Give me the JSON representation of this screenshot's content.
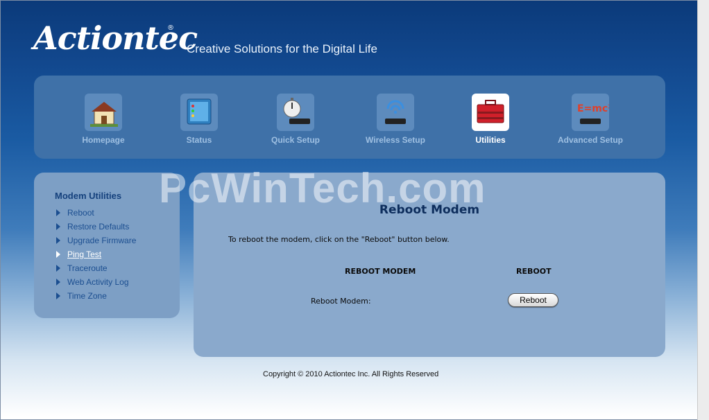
{
  "brand": {
    "logo_text": "Actiontec",
    "registered_mark": "®",
    "tagline": "Creative Solutions for the Digital Life"
  },
  "nav": {
    "items": [
      {
        "label": "Homepage",
        "icon": "house-icon"
      },
      {
        "label": "Status",
        "icon": "status-panel-icon"
      },
      {
        "label": "Quick Setup",
        "icon": "stopwatch-modem-icon"
      },
      {
        "label": "Wireless Setup",
        "icon": "wireless-modem-icon"
      },
      {
        "label": "Utilities",
        "icon": "toolbox-icon",
        "active": true
      },
      {
        "label": "Advanced Setup",
        "icon": "emc2-modem-icon"
      }
    ]
  },
  "sidebar": {
    "title": "Modem Utilities",
    "items": [
      {
        "label": "Reboot"
      },
      {
        "label": "Restore Defaults"
      },
      {
        "label": "Upgrade Firmware"
      },
      {
        "label": "Ping Test",
        "current": true
      },
      {
        "label": "Traceroute"
      },
      {
        "label": "Web Activity Log"
      },
      {
        "label": "Time Zone"
      }
    ]
  },
  "main": {
    "title": "Reboot Modem",
    "description": "To reboot the modem, click on the \"Reboot\" button below.",
    "col_header_1": "REBOOT MODEM",
    "col_header_2": "REBOOT",
    "row_label": "Reboot Modem:",
    "button_label": "Reboot"
  },
  "watermark": "PcWinTech.com",
  "footer": {
    "copyright": "Copyright © 2010 Actiontec Inc. All Rights Reserved"
  },
  "colors": {
    "header_blue": "#0b3a7a",
    "nav_panel": "#3f71a8",
    "content_panel": "#8aa9cc",
    "sidebar_panel": "#7d9fc5",
    "title_navy": "#0d2d5c"
  }
}
